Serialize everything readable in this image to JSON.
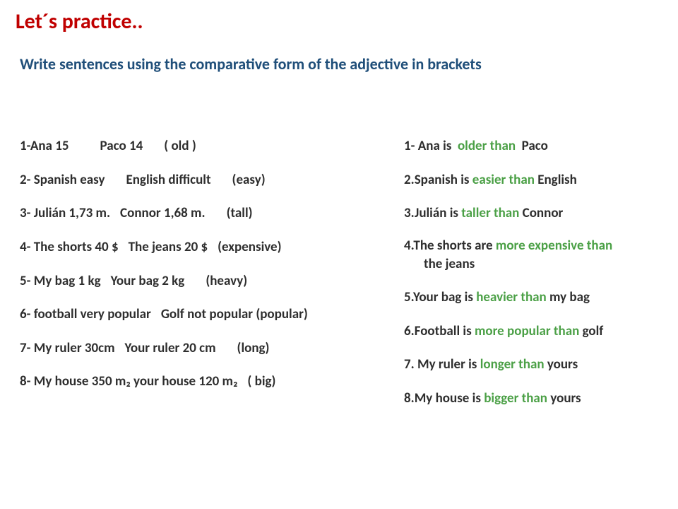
{
  "title": "Let´s practice..",
  "subtitle": "Write sentences using the comparative form of the adjective in brackets",
  "items": [
    {
      "prompt_a": "1-Ana  15",
      "prompt_b": "Paco  14",
      "prompt_c": "( old )",
      "ans_pre": "1- Ana  is",
      "ans_green": "older  than",
      "ans_post": "Paco"
    },
    {
      "prompt_a": "2- Spanish  easy",
      "prompt_b": "English  difficult",
      "prompt_c": "(easy)",
      "ans_pre": "2.Spanish  is",
      "ans_green": "easier than",
      "ans_post": "English"
    },
    {
      "prompt_a": "3- Julián 1,73 m.",
      "prompt_b": "Connor 1,68 m.",
      "prompt_c": "(tall)",
      "ans_pre": "3.Julián is",
      "ans_green": "taller than",
      "ans_post": "Connor"
    },
    {
      "prompt_a": "4- The shorts 40 $",
      "prompt_b": "The jeans  20 $",
      "prompt_c": "(expensive)",
      "ans_pre": "4.The shorts are",
      "ans_green": "more expensive than",
      "ans_post": "",
      "ans_tail": "the jeans"
    },
    {
      "prompt_a": "5- My bag 1 kg",
      "prompt_b": "Your bag  2 kg",
      "prompt_c": "(heavy)",
      "ans_pre": "5.Your bag is",
      "ans_green": "heavier than",
      "ans_post": "my bag"
    },
    {
      "prompt_a": "6- football very popular",
      "prompt_b": "Golf  not popular",
      "prompt_c": "(popular)",
      "ans_pre": "6.Football is",
      "ans_green": "more popular than",
      "ans_post": "golf"
    },
    {
      "prompt_a": "7- My ruler 30cm",
      "prompt_b": "Your ruler  20 cm",
      "prompt_c": "(long)",
      "ans_pre": "7. My ruler is",
      "ans_green": "longer than",
      "ans_post": "yours"
    },
    {
      "prompt_a": "8- My house 350 m₂",
      "prompt_b": "your house 120 m₂",
      "prompt_c": "( big)",
      "ans_pre": "8.My house is",
      "ans_green": "bigger than",
      "ans_post": "yours"
    }
  ]
}
